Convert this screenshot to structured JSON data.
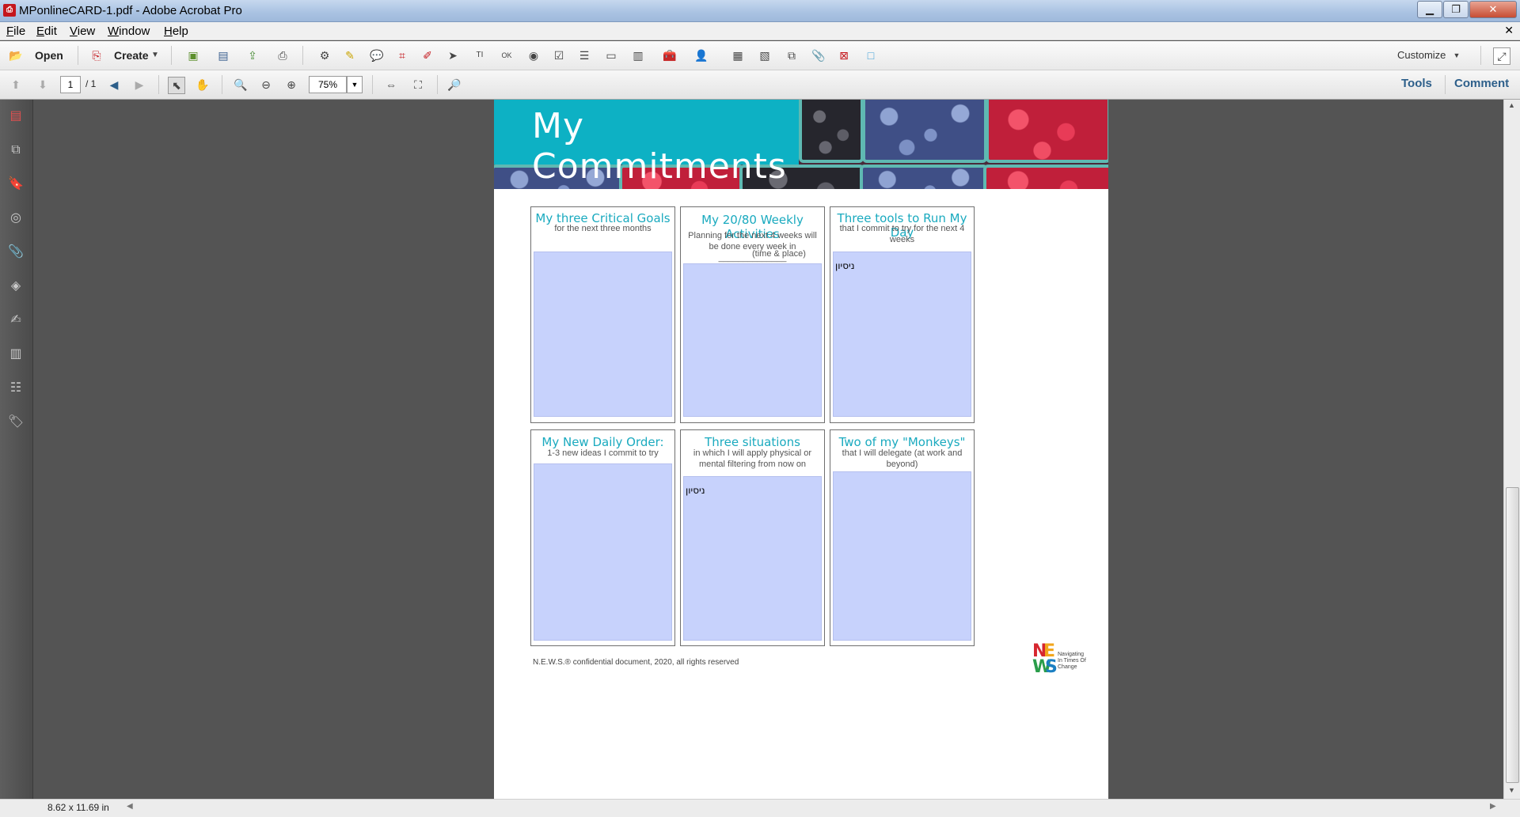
{
  "window": {
    "title": "MPonlineCARD-1.pdf - Adobe Acrobat Pro",
    "icon": "pdf-icon"
  },
  "menu": [
    "File",
    "Edit",
    "View",
    "Window",
    "Help"
  ],
  "toolbar": {
    "open_label": "Open",
    "create_label": "Create",
    "customize_label": "Customize",
    "page_current": "1",
    "page_total": "/ 1",
    "zoom": "75%",
    "tools_label": "Tools",
    "comment_label": "Comment"
  },
  "status": {
    "page_size": "8.62 x 11.69 in"
  },
  "document": {
    "heading": "My Commitments",
    "cards": [
      {
        "title": "My three Critical Goals",
        "subtitle": "for the next three months",
        "value": ""
      },
      {
        "title": "My 20/80 Weekly Activities",
        "subtitle": "Planning for the next 4 weeks will be done every week in ______________",
        "subtitle2": "(time & place)",
        "value": ""
      },
      {
        "title": "Three tools to Run My Day",
        "subtitle": "that I commit to try for the next 4 weeks",
        "value": "ניסיון"
      },
      {
        "title": "My New Daily Order:",
        "subtitle": "1-3 new ideas I commit to try",
        "value": ""
      },
      {
        "title": "Three situations",
        "subtitle": "in which I will apply physical or mental filtering from now on",
        "value": "ניסיון"
      },
      {
        "title": "Two of my \"Monkeys\"",
        "subtitle": "that I will delegate (at work and beyond)",
        "value": ""
      }
    ],
    "footer": "N.E.W.S.® confidential document, 2020, all rights reserved",
    "logo": {
      "letters": [
        "N",
        "E",
        "W",
        "S"
      ],
      "tagline": "Navigating In Times Of Change"
    }
  }
}
